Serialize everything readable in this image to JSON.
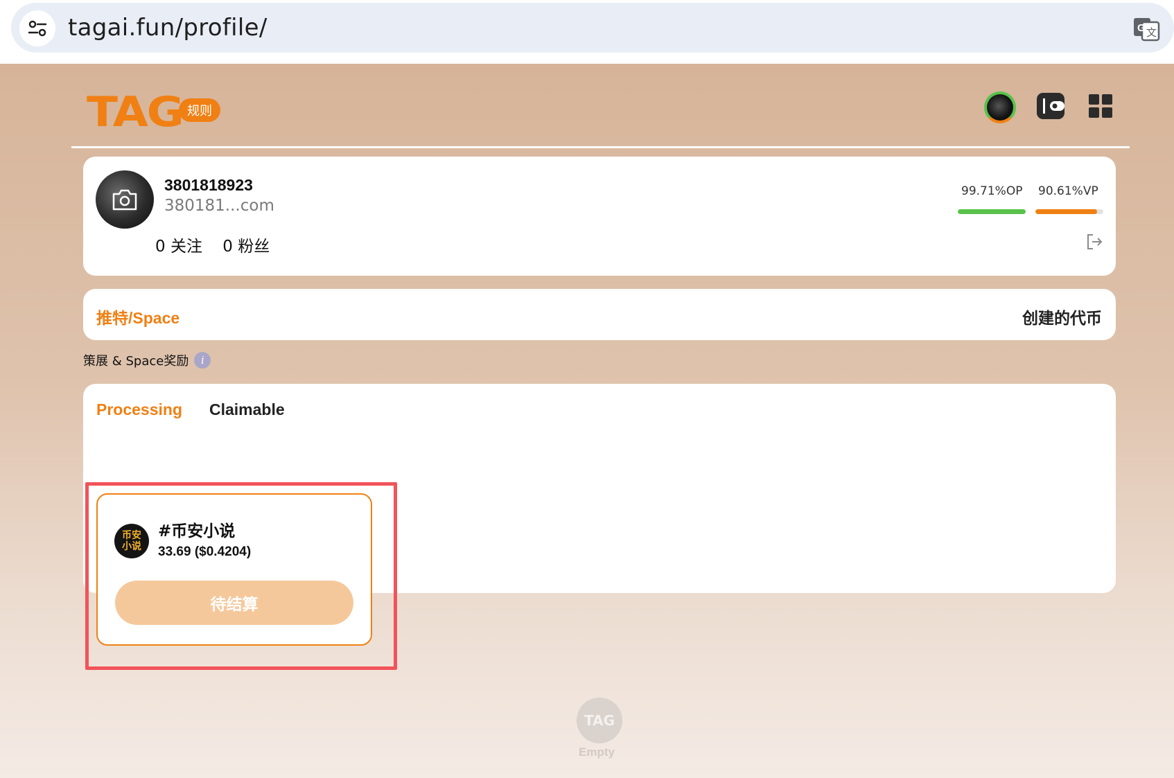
{
  "browser": {
    "url": "tagai.fun/profile/",
    "site_info_icon": "tune-icon",
    "translate_icon": "translate-icon"
  },
  "header": {
    "logo": "TAG",
    "rules_badge": "规则",
    "icons": [
      "avatar",
      "wallet-icon",
      "apps-grid-icon"
    ],
    "accent_color": "#f08013"
  },
  "profile": {
    "username": "3801818923",
    "email": "380181...com",
    "following": "0 关注",
    "followers": "0 粉丝",
    "op_label": "99.71%OP",
    "op_value": 0.9971,
    "op_color": "#59c24b",
    "vp_label": "90.61%VP",
    "vp_value": 0.9061,
    "vp_color": "#f08013"
  },
  "tabs": {
    "left": "推特/Space",
    "right": "创建的代币"
  },
  "section": {
    "label": "策展 & Space奖励",
    "info_icon": "i"
  },
  "rewards": {
    "subtabs": [
      "Processing",
      "Claimable"
    ],
    "active_subtab": "Processing",
    "items": [
      {
        "logo_text": "币安\n小说",
        "name": "#币安小说",
        "amount": "33.69 ($0.4204)",
        "button": "待结算"
      }
    ]
  },
  "empty": {
    "logo": "TAG",
    "text": "Empty"
  }
}
